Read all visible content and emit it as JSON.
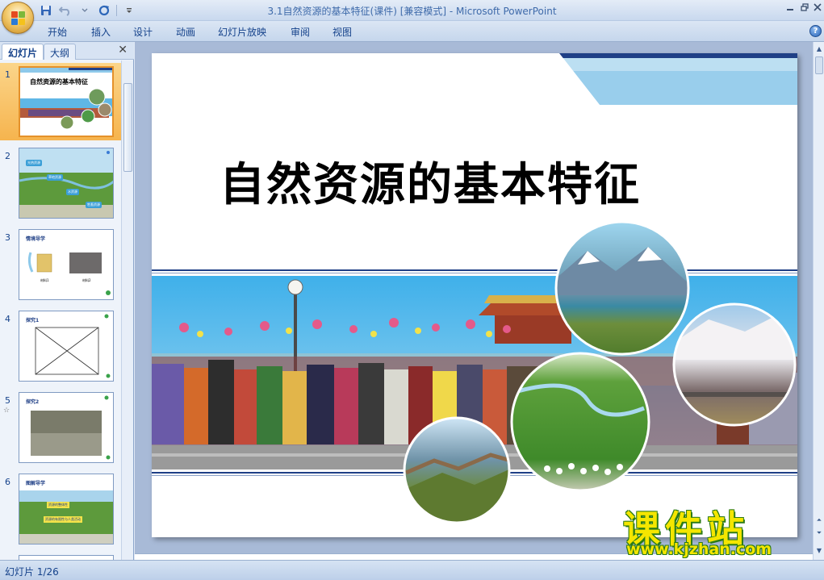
{
  "window": {
    "title": "3.1自然资源的基本特征(课件) [兼容模式] - Microsoft PowerPoint"
  },
  "ribbon": {
    "tabs": [
      "开始",
      "插入",
      "设计",
      "动画",
      "幻灯片放映",
      "审阅",
      "视图"
    ]
  },
  "left_pane": {
    "tabs": [
      "幻灯片",
      "大纲"
    ],
    "thumbnails": [
      {
        "number": "1",
        "title": "自然资源的基本特征"
      },
      {
        "number": "2",
        "labels": [
          "光热资源",
          "草地资源",
          "水资源",
          "牲畜资源"
        ]
      },
      {
        "number": "3",
        "title": "情境导学",
        "captions": [
          "材料1",
          "材料2"
        ]
      },
      {
        "number": "4",
        "title": "探究1"
      },
      {
        "number": "5",
        "title": "探究2"
      },
      {
        "number": "6",
        "title": "图解导学",
        "labels": [
          "资源的整体性",
          "资源的有限性与人类活动"
        ]
      }
    ]
  },
  "slide": {
    "title": "自然资源的基本特征"
  },
  "status": {
    "slide_counter": "幻灯片 1/26"
  },
  "watermark": {
    "title": "课件站",
    "url": "www.kjzhan.com"
  },
  "colors": {
    "accent": "#1f3f86",
    "light_blue": "#8ec9ea",
    "watermark_yellow": "#f4e600",
    "selection_orange": "#f6b44e"
  }
}
